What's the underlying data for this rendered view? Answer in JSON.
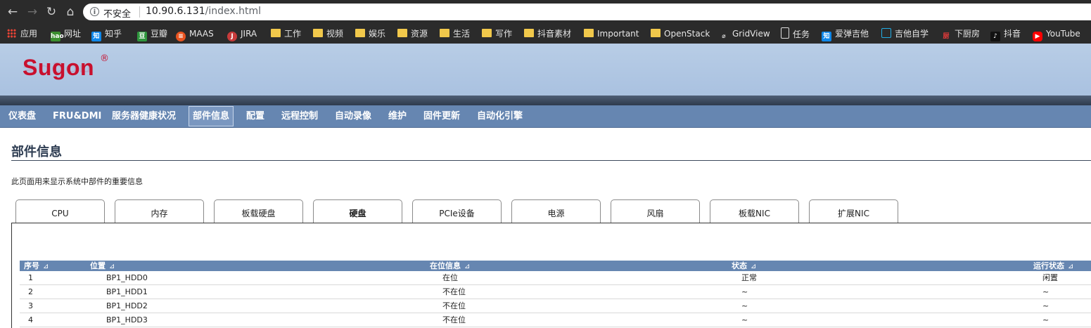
{
  "browser": {
    "insecure_label": "不安全",
    "url_host": "10.90.6.131",
    "url_path": "/index.html"
  },
  "bookmarks": [
    {
      "label": "应用",
      "icon": "apps-icon"
    },
    {
      "label": "网址",
      "icon": "hao-icon"
    },
    {
      "label": "知乎",
      "icon": "zhihu-icon"
    },
    {
      "label": "豆瓣",
      "icon": "douban-icon"
    },
    {
      "label": "MAAS",
      "icon": "maas-icon"
    },
    {
      "label": "JIRA",
      "icon": "jira-icon"
    },
    {
      "label": "工作",
      "icon": "folder-icon"
    },
    {
      "label": "视频",
      "icon": "folder-icon"
    },
    {
      "label": "娱乐",
      "icon": "folder-icon"
    },
    {
      "label": "资源",
      "icon": "folder-icon"
    },
    {
      "label": "生活",
      "icon": "folder-icon"
    },
    {
      "label": "写作",
      "icon": "folder-icon"
    },
    {
      "label": "抖音素材",
      "icon": "folder-icon"
    },
    {
      "label": "Important",
      "icon": "folder-icon"
    },
    {
      "label": "OpenStack",
      "icon": "folder-icon"
    },
    {
      "label": "GridView",
      "icon": "gridview-icon"
    },
    {
      "label": "任务",
      "icon": "page-icon"
    },
    {
      "label": "爱弹吉他",
      "icon": "zhihu-icon"
    },
    {
      "label": "吉他自学",
      "icon": "bilibili-icon"
    },
    {
      "label": "下厨房",
      "icon": "xiachufang-icon"
    },
    {
      "label": "抖音",
      "icon": "tiktok-icon"
    },
    {
      "label": "YouTube",
      "icon": "youtube-icon"
    }
  ],
  "logo": {
    "text": "Sugon",
    "reg": "®"
  },
  "menu": [
    "仪表盘",
    "FRU&DMI",
    "服务器健康状况",
    "部件信息",
    "配置",
    "远程控制",
    "自动录像",
    "维护",
    "固件更新",
    "自动化引擎"
  ],
  "menu_active": "部件信息",
  "page": {
    "title": "部件信息",
    "description": "此页面用来显示系统中部件的重要信息"
  },
  "tabs": [
    "CPU",
    "内存",
    "板载硬盘",
    "硬盘",
    "PCIe设备",
    "电源",
    "风扇",
    "板载NIC",
    "扩展NIC"
  ],
  "tab_active": "硬盘",
  "table": {
    "sort_glyph": "⊿",
    "headers": [
      "序号",
      "位置",
      "在位信息",
      "状态",
      "运行状态"
    ],
    "rows": [
      [
        "1",
        "BP1_HDD0",
        "在位",
        "正常",
        "闲置"
      ],
      [
        "2",
        "BP1_HDD1",
        "不在位",
        "~",
        "~"
      ],
      [
        "3",
        "BP1_HDD2",
        "不在位",
        "~",
        "~"
      ],
      [
        "4",
        "BP1_HDD3",
        "不在位",
        "~",
        "~"
      ]
    ]
  },
  "colors": {
    "menu_bar": "#6686b1",
    "brand_red": "#c8102e",
    "header_bg": "#b8cde6"
  }
}
